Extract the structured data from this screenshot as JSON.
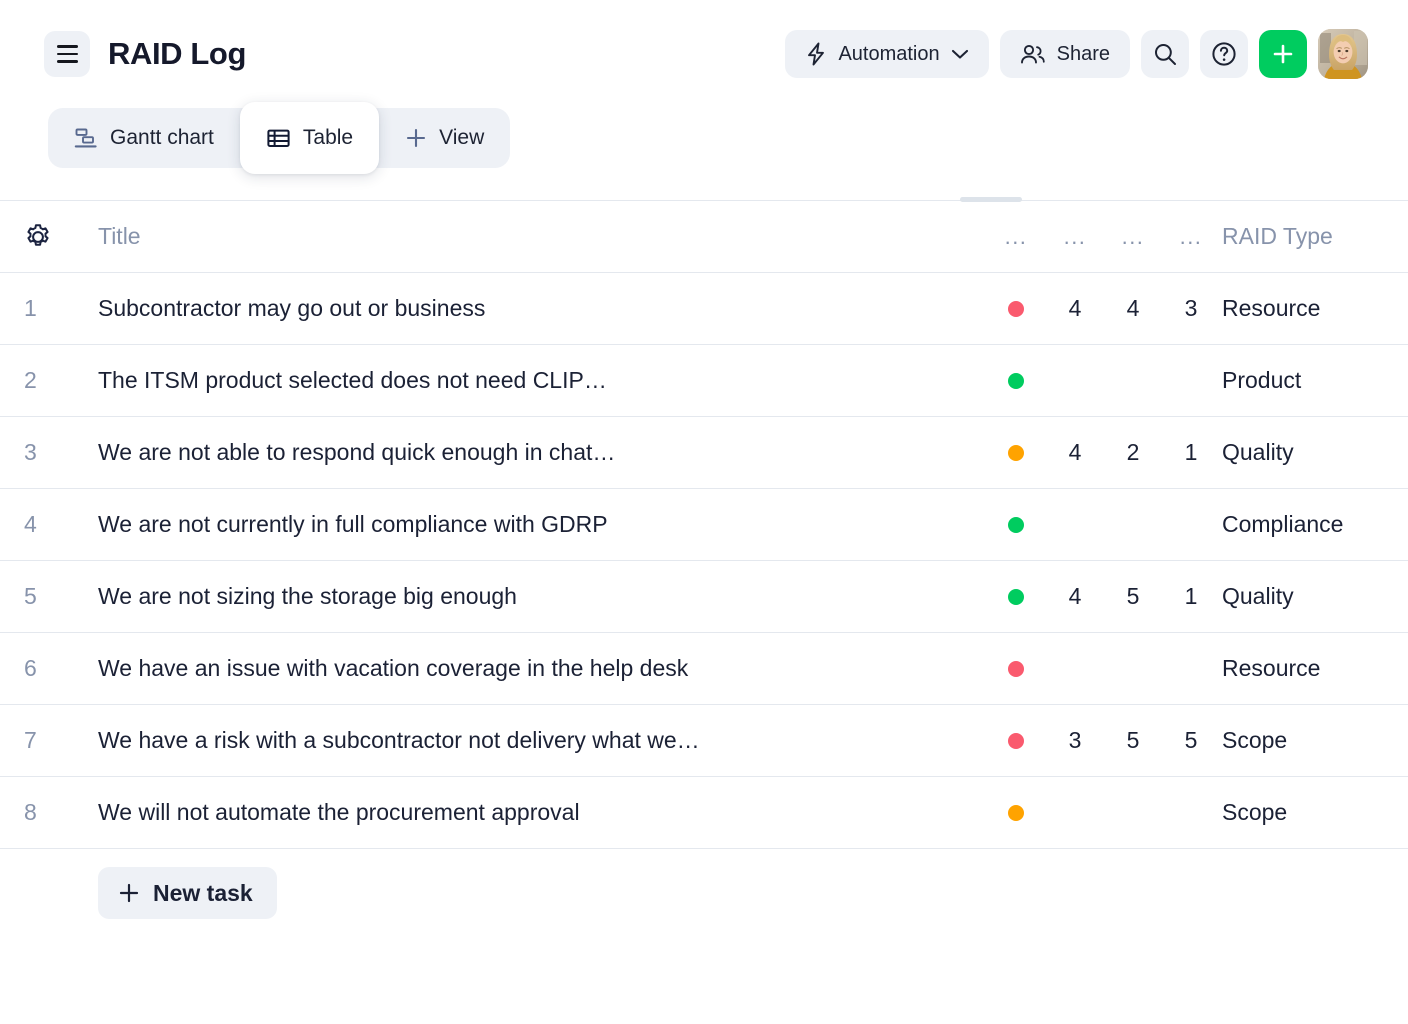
{
  "header": {
    "menu_icon": "hamburger-menu-icon",
    "title": "RAID Log",
    "automation_label": "Automation",
    "automation_icon": "lightning-bolt-icon",
    "automation_chevron": "chevron-down-icon",
    "share_label": "Share",
    "share_icon": "people-icon",
    "search_icon": "search-icon",
    "help_icon": "question-circle-icon",
    "add_icon": "plus-icon",
    "avatar_icon": "user-avatar-photo"
  },
  "views": {
    "items": [
      {
        "label": "Gantt chart",
        "icon": "gantt-chart-icon",
        "active": false
      },
      {
        "label": "Table",
        "icon": "table-grid-icon",
        "active": true
      },
      {
        "label": "View",
        "icon": "plus-icon",
        "active": false
      }
    ]
  },
  "table": {
    "settings_icon": "gear-icon",
    "columns": {
      "index": "",
      "title": "Title",
      "status": "...",
      "col2": "...",
      "col3": "...",
      "col4": "...",
      "raid_type": "RAID Type"
    },
    "rows": [
      {
        "index": "1",
        "title": "Subcontractor may go out or business",
        "status_color": "#fa5a6e",
        "status_name": "red",
        "v1": "4",
        "v2": "4",
        "v3": "3",
        "raid_type": "Resource"
      },
      {
        "index": "2",
        "title": "The ITSM product selected does not need CLIP…",
        "status_color": "#00cc5f",
        "status_name": "green",
        "v1": "",
        "v2": "",
        "v3": "",
        "raid_type": "Product"
      },
      {
        "index": "3",
        "title": "We are not able to respond quick enough in chat…",
        "status_color": "#ffa300",
        "status_name": "orange",
        "v1": "4",
        "v2": "2",
        "v3": "1",
        "raid_type": "Quality"
      },
      {
        "index": "4",
        "title": "We are not currently in full compliance with GDRP",
        "status_color": "#00cc5f",
        "status_name": "green",
        "v1": "",
        "v2": "",
        "v3": "",
        "raid_type": "Compliance"
      },
      {
        "index": "5",
        "title": "We are not sizing the storage big enough",
        "status_color": "#00cc5f",
        "status_name": "green",
        "v1": "4",
        "v2": "5",
        "v3": "1",
        "raid_type": "Quality"
      },
      {
        "index": "6",
        "title": "We have an issue with vacation coverage in the help desk",
        "status_color": "#fa5a6e",
        "status_name": "red",
        "v1": "",
        "v2": "",
        "v3": "",
        "raid_type": "Resource"
      },
      {
        "index": "7",
        "title": "We have a risk with a subcontractor not delivery what we…",
        "status_color": "#fa5a6e",
        "status_name": "red",
        "v1": "3",
        "v2": "5",
        "v3": "5",
        "raid_type": "Scope"
      },
      {
        "index": "8",
        "title": "We will not automate the procurement approval",
        "status_color": "#ffa300",
        "status_name": "orange",
        "v1": "",
        "v2": "",
        "v3": "",
        "raid_type": "Scope"
      }
    ],
    "new_task_label": "New task",
    "new_task_icon": "plus-icon"
  },
  "colors": {
    "accent_green": "#00cc5f",
    "status_red": "#fa5a6e",
    "status_green": "#00cc5f",
    "status_orange": "#ffa300",
    "chrome_gray": "#eef1f6",
    "text_dark": "#1b2135",
    "text_muted": "#8793ab",
    "divider": "#e4e8ee"
  }
}
